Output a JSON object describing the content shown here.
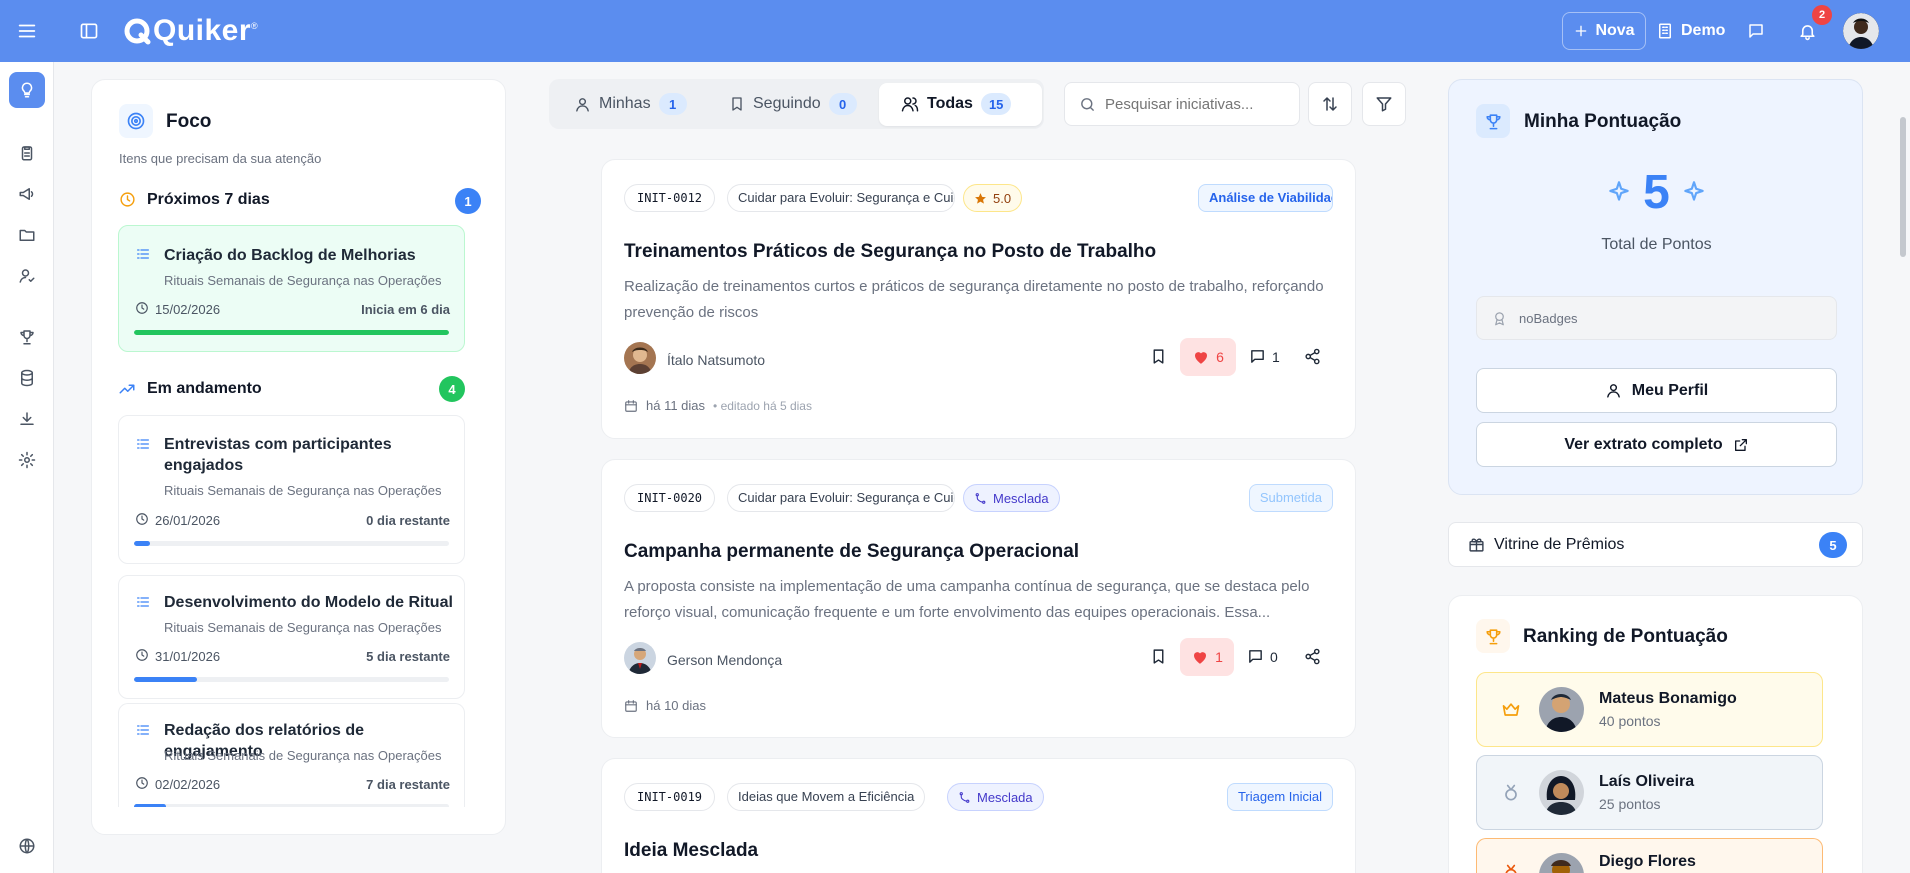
{
  "header": {
    "logo_text": "Quiker",
    "logo_mark": "®",
    "new_button_label": "Nova",
    "workspace_label": "Demo",
    "notification_count": "2"
  },
  "tabs": [
    {
      "label": "Minhas",
      "count": "1"
    },
    {
      "label": "Seguindo",
      "count": "0"
    },
    {
      "label": "Todas",
      "count": "15"
    }
  ],
  "search": {
    "placeholder": "Pesquisar iniciativas..."
  },
  "focus": {
    "title": "Foco",
    "subtitle": "Itens que precisam da sua atenção",
    "next7": {
      "label": "Próximos 7 dias",
      "count": "1",
      "items": [
        {
          "title": "Criação do Backlog de Melhorias",
          "subtitle": "Rituais Semanais de Segurança nas Operações",
          "date": "15/02/2026",
          "remaining": "Inicia em 6 dia",
          "progress": 1.0
        }
      ]
    },
    "in_progress": {
      "label": "Em andamento",
      "count": "4",
      "items": [
        {
          "title": "Entrevistas com participantes engajados",
          "subtitle": "Rituais Semanais de Segurança nas Operações",
          "date": "26/01/2026",
          "remaining": "0 dia restante",
          "progress": 0.05
        },
        {
          "title": "Desenvolvimento do Modelo de Ritual",
          "subtitle": "Rituais Semanais de Segurança nas Operações",
          "date": "31/01/2026",
          "remaining": "5 dia restante",
          "progress": 0.2
        },
        {
          "title": "Redação dos relatórios de engajamento",
          "subtitle": "Rituais Semanais de Segurança nas Operações",
          "date": "02/02/2026",
          "remaining": "7 dia restante",
          "progress": 0.1
        }
      ]
    }
  },
  "initiatives": [
    {
      "code": "INIT-0012",
      "challenge": "Cuidar para Evoluir: Segurança e Cuidado",
      "rating": "5.0",
      "stage": "Análise de Viabilidade",
      "title": "Treinamentos Práticos de Segurança no Posto de Trabalho",
      "description": "Realização de treinamentos curtos e práticos de segurança diretamente no posto de trabalho, reforçando prevenção de riscos",
      "author": "Ítalo Natsumoto",
      "likes": "6",
      "comments": "1",
      "created": "há 11 dias",
      "edited": "• editado há 5 dias"
    },
    {
      "code": "INIT-0020",
      "challenge": "Cuidar para Evoluir: Segurança e Cuidado",
      "tag": "Mesclada",
      "stage": "Submetida",
      "title": "Campanha permanente de Segurança Operacional",
      "description": "A proposta consiste na implementação de uma campanha contínua de segurança, que se destaca pelo reforço visual, comunicação frequente e um forte envolvimento das equipes operacionais. Essa...",
      "author": "Gerson Mendonça",
      "likes": "1",
      "comments": "0",
      "created": "há 10 dias"
    },
    {
      "code": "INIT-0019",
      "challenge": "Ideias que Movem a Eficiência",
      "tag": "Mesclada",
      "stage": "Triagem Inicial",
      "title": "Ideia Mesclada"
    }
  ],
  "points": {
    "title": "Minha Pontuação",
    "value": "5",
    "label": "Total de Pontos",
    "badges_placeholder": "noBadges",
    "profile_button": "Meu Perfil",
    "statement_button": "Ver extrato completo"
  },
  "prizes": {
    "label": "Vitrine de Prêmios",
    "count": "5"
  },
  "ranking": {
    "title": "Ranking de Pontuação",
    "entries": [
      {
        "name": "Mateus Bonamigo",
        "points": "40 pontos"
      },
      {
        "name": "Laís Oliveira",
        "points": "25 pontos"
      },
      {
        "name": "Diego Flores",
        "points": ""
      }
    ]
  },
  "colors": {
    "header": "#5b8def",
    "accent": "#3b82f6",
    "success": "#22c55e",
    "like": "#ef4444"
  }
}
